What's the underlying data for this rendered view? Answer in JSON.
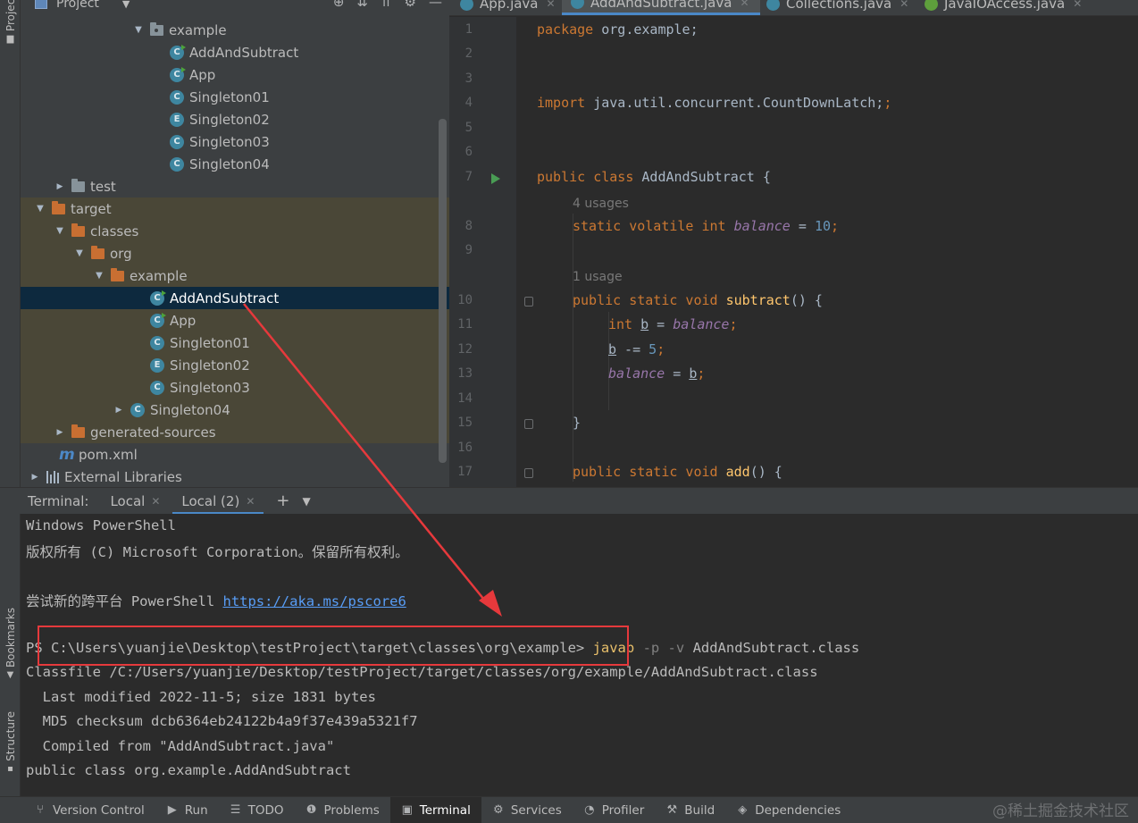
{
  "left_strip": {
    "project_tab": "Project",
    "bookmarks_tab": "Bookmarks",
    "structure_tab": "Structure"
  },
  "project_panel": {
    "title": "Project",
    "tree": [
      {
        "label": "example",
        "kind": "package",
        "arrow": "open"
      },
      {
        "label": "AddAndSubtract",
        "kind": "class-main"
      },
      {
        "label": "App",
        "kind": "class-main"
      },
      {
        "label": "Singleton01",
        "kind": "class"
      },
      {
        "label": "Singleton02",
        "kind": "enum",
        "badge": "E"
      },
      {
        "label": "Singleton03",
        "kind": "class"
      },
      {
        "label": "Singleton04",
        "kind": "class"
      },
      {
        "label": "test",
        "kind": "folder-grey",
        "arrow": "closed"
      },
      {
        "label": "target",
        "kind": "folder-orange",
        "arrow": "open"
      },
      {
        "label": "classes",
        "kind": "folder-orange",
        "arrow": "open"
      },
      {
        "label": "org",
        "kind": "folder-orange",
        "arrow": "open"
      },
      {
        "label": "example",
        "kind": "folder-orange",
        "arrow": "open"
      },
      {
        "label": "AddAndSubtract",
        "kind": "class-main",
        "selected": true
      },
      {
        "label": "App",
        "kind": "class-main"
      },
      {
        "label": "Singleton01",
        "kind": "class"
      },
      {
        "label": "Singleton02",
        "kind": "enum",
        "badge": "E"
      },
      {
        "label": "Singleton03",
        "kind": "class"
      },
      {
        "label": "Singleton04",
        "kind": "class",
        "arrow": "closed"
      },
      {
        "label": "generated-sources",
        "kind": "folder-orange",
        "arrow": "closed"
      },
      {
        "label": "pom.xml",
        "kind": "maven"
      },
      {
        "label": "External Libraries",
        "kind": "library",
        "arrow": "closed"
      }
    ]
  },
  "editor_tabs": [
    {
      "label": "App.java",
      "icon": "class-icon"
    },
    {
      "label": "AddAndSubtract.java",
      "icon": "class-icon",
      "active": true
    },
    {
      "label": "Collections.java",
      "icon": "class-icon"
    },
    {
      "label": "JavaIOAccess.java",
      "icon": "interface-icon"
    }
  ],
  "editor": {
    "line_numbers": [
      "1",
      "2",
      "3",
      "4",
      "5",
      "6",
      "7",
      "8",
      "9",
      "10",
      "11",
      "12",
      "13",
      "14",
      "15",
      "16",
      "17"
    ],
    "hints": {
      "four_usages": "4 usages",
      "one_usage": "1 usage"
    },
    "code": {
      "l1_kw": "package",
      "l1_rest": " org.example;",
      "l4_kw": "import",
      "l4_rest": " java.util.concurrent.CountDownLatch;",
      "l7_kw": "public class",
      "l7_rest": " AddAndSubtract {",
      "l8_kw": "static volatile int",
      "l8_field": "balance",
      "l8_eq": " = ",
      "l8_num": "10",
      "l8_end": ";",
      "l10_kw": "public static void",
      "l10_fn": "subtract",
      "l10_end": "() {",
      "l11_kw": "int",
      "l11_var": "b",
      "l11_eq": " = ",
      "l11_field": "balance",
      "l11_end": ";",
      "l12_var": "b",
      "l12_op": " -= ",
      "l12_num": "5",
      "l12_end": ";",
      "l13_field": "balance",
      "l13_eq": " = ",
      "l13_var": "b",
      "l13_end": ";",
      "l15": "}",
      "l17_kw": "public static void",
      "l17_fn": "add",
      "l17_end": "() {"
    }
  },
  "terminal": {
    "header_label": "Terminal:",
    "tabs": [
      {
        "label": "Local"
      },
      {
        "label": "Local (2)",
        "active": true
      }
    ],
    "lines": {
      "l1": "Windows PowerShell",
      "l2": "版权所有 (C) Microsoft Corporation。保留所有权利。",
      "l3_text": "尝试新的跨平台 PowerShell ",
      "l3_link": "https://aka.ms/pscore6",
      "l4_prompt": "PS C:\\Users\\yuanjie\\Desktop\\testProject\\target\\classes\\org\\example> ",
      "l4_cmd": "javap",
      "l4_params": " -p -v ",
      "l4_arg": "AddAndSubtract.class",
      "l5": "Classfile /C:/Users/yuanjie/Desktop/testProject/target/classes/org/example/AddAndSubtract.class",
      "l6": "  Last modified 2022-11-5; size 1831 bytes",
      "l7": "  MD5 checksum dcb6364eb24122b4a9f37e439a5321f7",
      "l8": "  Compiled from \"AddAndSubtract.java\"",
      "l9": "public class org.example.AddAndSubtract"
    }
  },
  "status_bar": [
    {
      "label": "Version Control",
      "icon": "branch-icon"
    },
    {
      "label": "Run",
      "icon": "run-icon"
    },
    {
      "label": "TODO",
      "icon": "list-icon"
    },
    {
      "label": "Problems",
      "icon": "problems-icon"
    },
    {
      "label": "Terminal",
      "icon": "terminal-icon",
      "active": true
    },
    {
      "label": "Services",
      "icon": "services-icon"
    },
    {
      "label": "Profiler",
      "icon": "profiler-icon"
    },
    {
      "label": "Build",
      "icon": "build-icon"
    },
    {
      "label": "Dependencies",
      "icon": "dependencies-icon"
    }
  ],
  "watermark": "@稀土掘金技术社区",
  "colors": {
    "annotation_red": "#e6393c",
    "selection": "#0d293e",
    "highlight_row": "#4a4737",
    "tab_underline": "#4a88c7"
  }
}
